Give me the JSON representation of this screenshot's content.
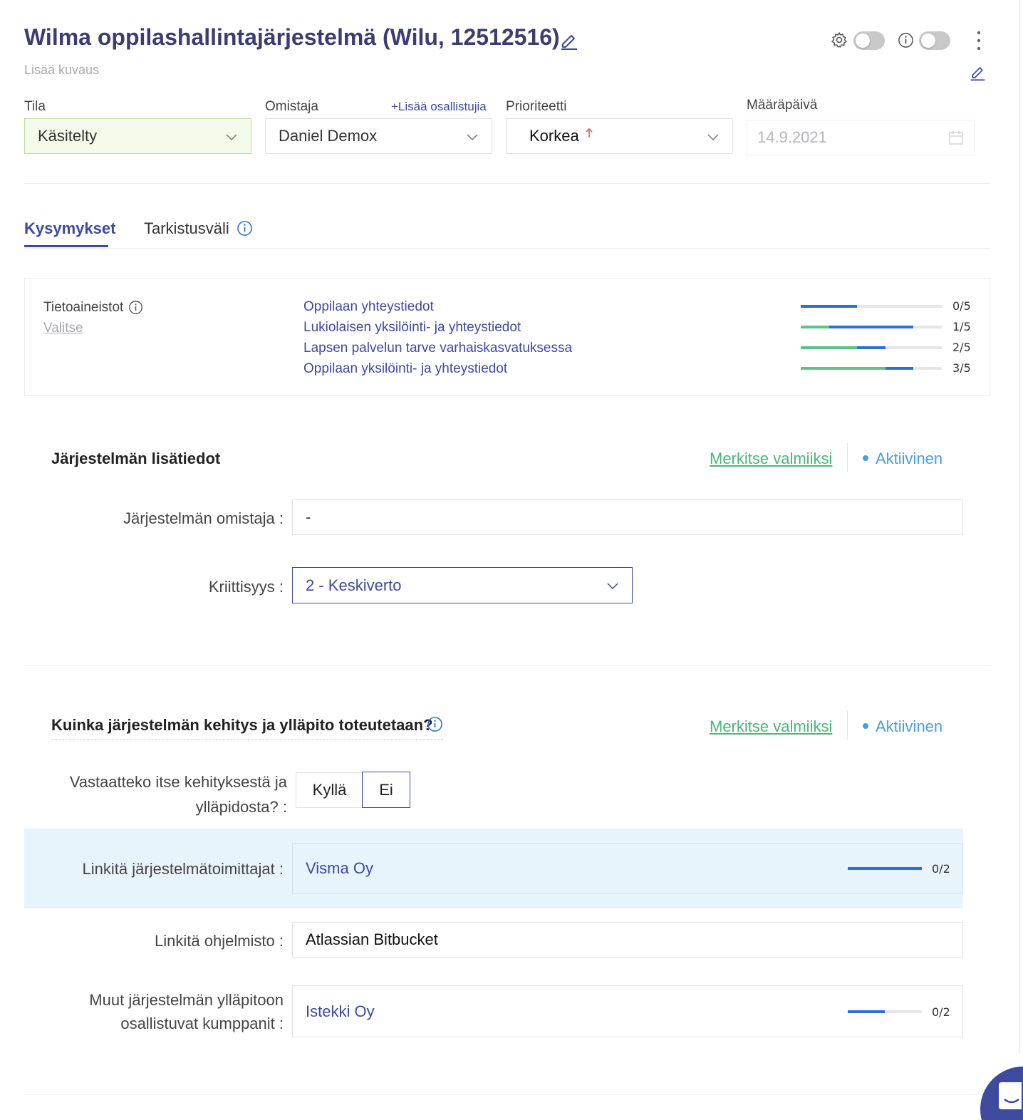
{
  "header": {
    "title": "Wilma oppilashallintajärjestelmä (Wilu, 12512516)",
    "description_placeholder": "Lisää kuvaus"
  },
  "fields": {
    "tila_label": "Tila",
    "tila_value": "Käsitelty",
    "omistaja_label": "Omistaja",
    "add_participants": "+Lisää osallistujia",
    "omistaja_value": "Daniel Demox",
    "prioriteetti_label": "Prioriteetti",
    "prioriteetti_value": "Korkea",
    "maarapaiva_label": "Määräpäivä",
    "maarapaiva_value": "14.9.2021"
  },
  "tabs": [
    {
      "label": "Kysymykset",
      "active": true
    },
    {
      "label": "Tarkistusväli",
      "active": false
    }
  ],
  "datasets": {
    "label": "Tietoaineistot",
    "select_link": "Valitse",
    "items": [
      {
        "name": "Oppilaan yhteystiedot",
        "count": "0/5",
        "green": 0.0,
        "blue": 0.4
      },
      {
        "name": "Lukiolaisen yksilöinti- ja yhteystiedot",
        "count": "1/5",
        "green": 0.2,
        "blue": 0.6
      },
      {
        "name": "Lapsen palvelun tarve varhaiskasvatuksessa",
        "count": "2/5",
        "green": 0.4,
        "blue": 0.2
      },
      {
        "name": "Oppilaan yksilöinti- ja yhteystiedot",
        "count": "3/5",
        "green": 0.6,
        "blue": 0.2
      }
    ]
  },
  "section1": {
    "title": "Järjestelmän lisätiedot",
    "mark_done": "Merkitse valmiiksi",
    "status": "Aktiivinen",
    "owner_label": "Järjestelmän omistaja :",
    "owner_value": "-",
    "criticality_label": "Kriittisyys :",
    "criticality_value": "2 - Keskiverto"
  },
  "section2": {
    "title": "Kuinka järjestelmän kehitys ja ylläpito toteutetaan?",
    "mark_done": "Merkitse valmiiksi",
    "status": "Aktiivinen",
    "q_responsible_line1": "Vastaatteko itse kehityksestä ja",
    "q_responsible_line2": "ylläpidosta? :",
    "yes": "Kyllä",
    "no": "Ei",
    "selected": "Ei",
    "vendors_label": "Linkitä järjestelmätoimittajat :",
    "vendors_value": "Visma Oy",
    "vendors_count": "0/2",
    "vendors_progress": 1.0,
    "software_label": "Linkitä ohjelmisto :",
    "software_value": "Atlassian Bitbucket",
    "partners_label_line1": "Muut järjestelmän ylläpitoon",
    "partners_label_line2": "osallistuvat kumppanit :",
    "partners_value": "Istekki Oy",
    "partners_count": "0/2",
    "partners_progress": 0.5
  },
  "colors": {
    "accent": "#3d4a9e",
    "green": "#4bb67e",
    "blue_status": "#4a9de0",
    "tila_bg": "#f4fbea",
    "highlight_row": "#e8f4fc"
  }
}
